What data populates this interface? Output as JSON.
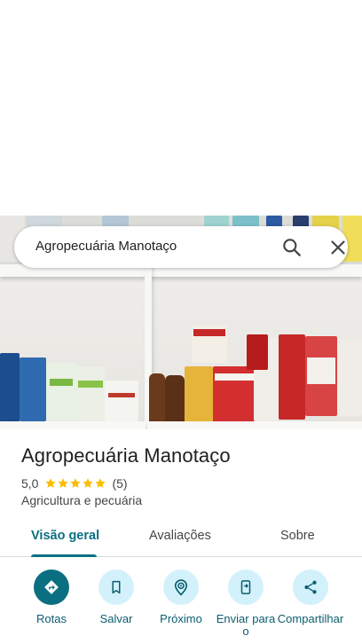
{
  "search": {
    "query": "Agropecuária Manotaço"
  },
  "place": {
    "name": "Agropecuária Manotaço",
    "rating": "5,0",
    "stars": 5,
    "review_count": "(5)",
    "category": "Agricultura e pecuária"
  },
  "tabs": [
    {
      "label": "Visão geral",
      "active": true
    },
    {
      "label": "Avaliações",
      "active": false
    },
    {
      "label": "Sobre",
      "active": false
    }
  ],
  "actions": [
    {
      "label": "Rotas",
      "icon": "directions-icon"
    },
    {
      "label": "Salvar",
      "icon": "bookmark-icon"
    },
    {
      "label": "Próximo",
      "icon": "nearby-icon"
    },
    {
      "label": "Enviar para o",
      "icon": "send-to-phone-icon"
    },
    {
      "label": "Compartilhar",
      "icon": "share-icon"
    }
  ],
  "colors": {
    "accent": "#0b6f82",
    "action_bg": "#d3f1fb",
    "star": "#fbbc04"
  }
}
